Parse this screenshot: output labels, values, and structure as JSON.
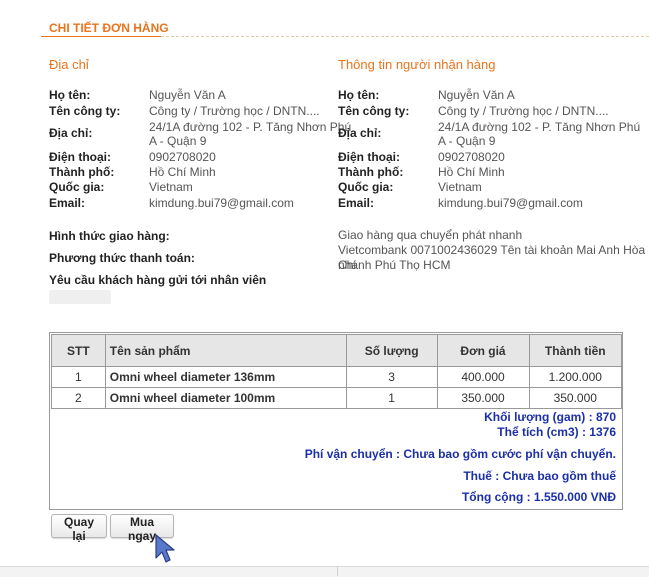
{
  "section_title": "CHI TIẾT ĐƠN HÀNG",
  "billing": {
    "heading": "Địa chỉ",
    "name_label": "Họ tên:",
    "name": "Nguyễn Văn A",
    "company_label": "Tên công ty:",
    "company": "Công ty / Trường học / DNTN....",
    "address_label": "Địa chỉ:",
    "address_line1": "24/1A đường 102 - P. Tăng Nhơn Phú",
    "address_line2": "A - Quận 9",
    "phone_label": "Điện thoại:",
    "phone": "0902708020",
    "city_label": "Thành phố:",
    "city": "Hồ Chí Minh",
    "country_label": "Quốc gia:",
    "country": "Vietnam",
    "email_label": "Email:",
    "email": "kimdung.bui79@gmail.com"
  },
  "recipient": {
    "heading": "Thông tin người nhận hàng",
    "name_label": "Họ tên:",
    "name": "Nguyễn Văn A",
    "company_label": "Tên công ty:",
    "company": "Công ty / Trường học / DNTN....",
    "address_label": "Địa chỉ:",
    "address_line1": "24/1A đường 102 - P. Tăng Nhơn Phú",
    "address_line2": "A - Quận 9",
    "phone_label": "Điện thoại:",
    "phone": "0902708020",
    "city_label": "Thành phố:",
    "city": "Hồ Chí Minh",
    "country_label": "Quốc gia:",
    "country": "Vietnam",
    "email_label": "Email:",
    "email": "kimdung.bui79@gmail.com"
  },
  "shipping": {
    "method_label": "Hình thức giao hàng:",
    "method_value": "Giao hàng qua chuyển phát nhanh",
    "payment_label": "Phương thức thanh toán:",
    "payment_value_line1": "Vietcombank 0071002436029 Tên tài khoản Mai Anh Hòa Chi",
    "payment_value_line2": "nhánh Phú Thọ HCM",
    "request_label": "Yêu cầu khách hàng gửi tới nhân viên"
  },
  "table": {
    "headers": [
      "STT",
      "Tên sản phẩm",
      "Số lượng",
      "Đơn giá",
      "Thành tiền"
    ],
    "rows": [
      [
        "1",
        "Omni wheel diameter 136mm",
        "3",
        "400.000",
        "1.200.000"
      ],
      [
        "2",
        "Omni wheel diameter 100mm",
        "1",
        "350.000",
        "350.000"
      ]
    ]
  },
  "summary": {
    "weight": "Khối lượng (gam) : 870",
    "volume": "Thể tích (cm3) : 1376",
    "shipping_fee": "Phí vận chuyển : Chưa bao gồm cước phí vận chuyển.",
    "tax": "Thuế : Chưa bao gồm thuế",
    "total": "Tổng cộng : 1.550.000 VNĐ"
  },
  "buttons": {
    "back": "Quay lại",
    "buy": "Mua ngay"
  },
  "colors": {
    "accent": "#e8741e",
    "summary_text": "#1b2fa8",
    "table_header_bg": "#e6e6e6"
  },
  "icons": {
    "cursor": "mouse-pointer-icon"
  }
}
